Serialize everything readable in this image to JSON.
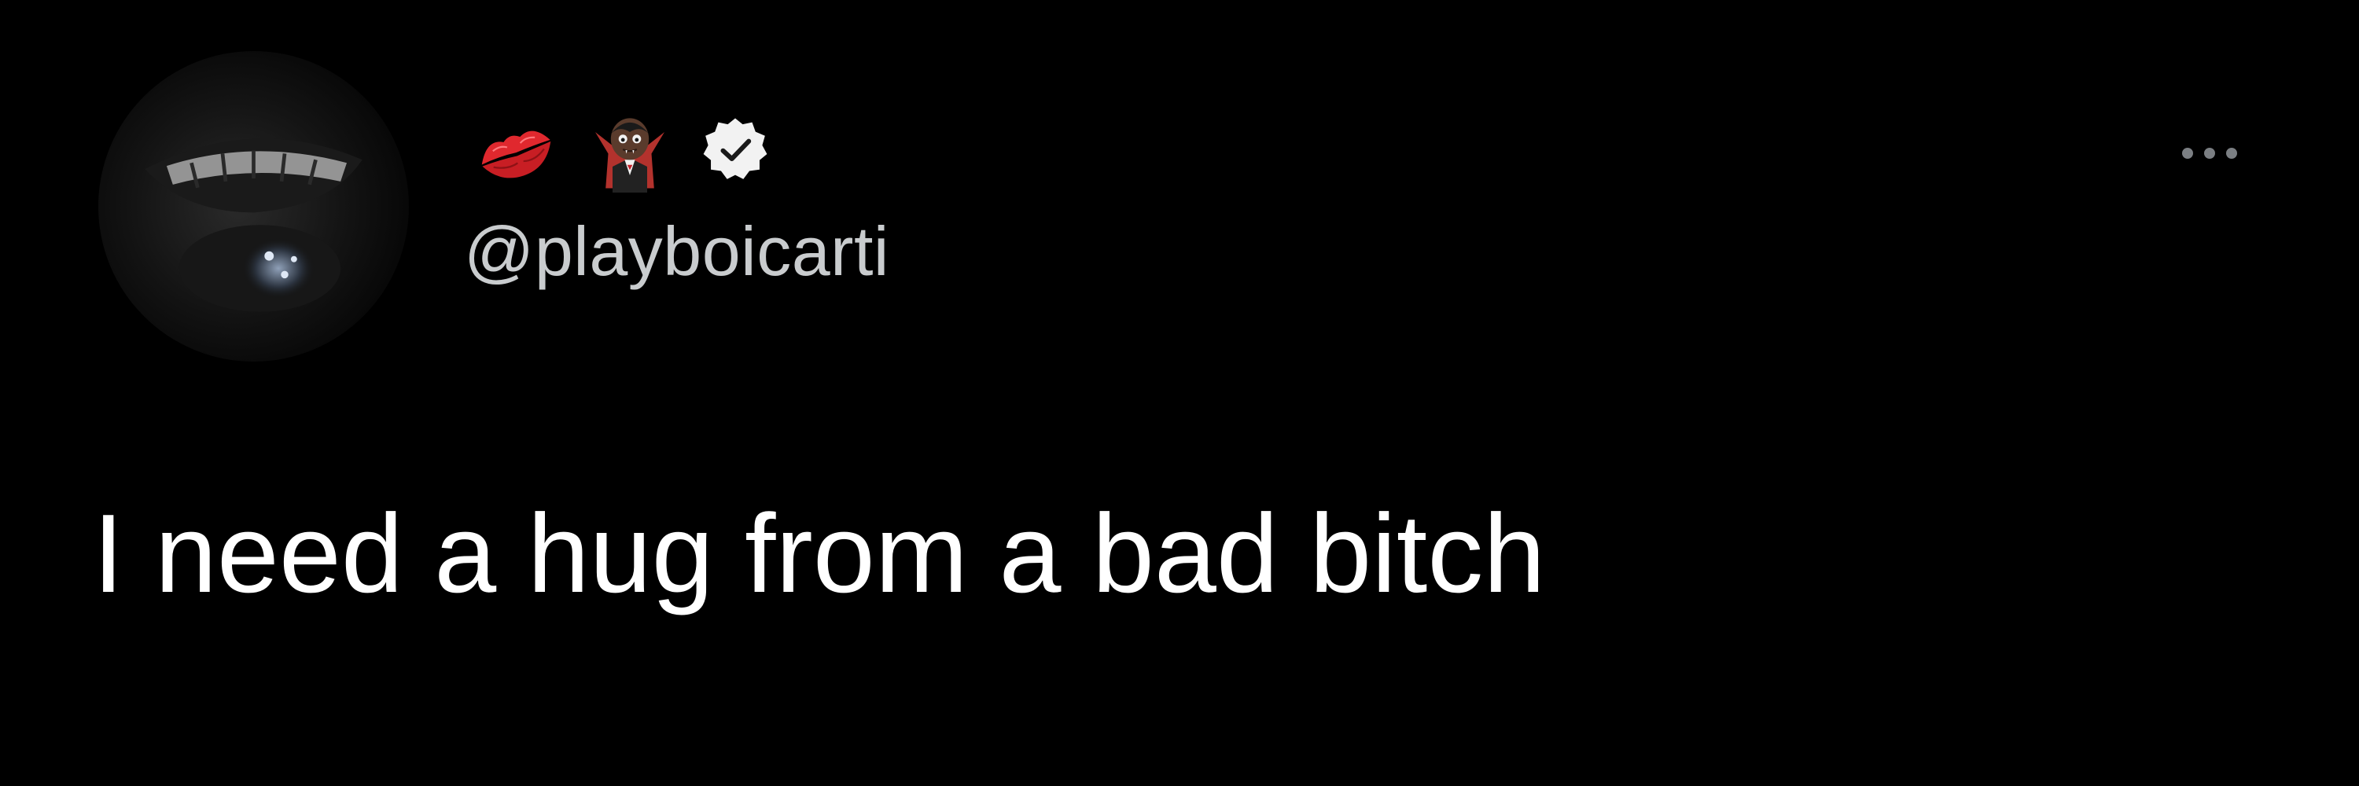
{
  "tweet": {
    "handle": "@playboicarti",
    "text": "I need a hug from a bad bitch",
    "name_icons": [
      "kiss-mark-icon",
      "vampire-icon",
      "verified-badge-icon"
    ],
    "more_icon": "more-options-icon"
  },
  "colors": {
    "background": "#000000",
    "text": "#ffffff",
    "handle": "#c9ccce",
    "kiss": "#e0282e",
    "verified_badge": "#f2f2f2"
  }
}
